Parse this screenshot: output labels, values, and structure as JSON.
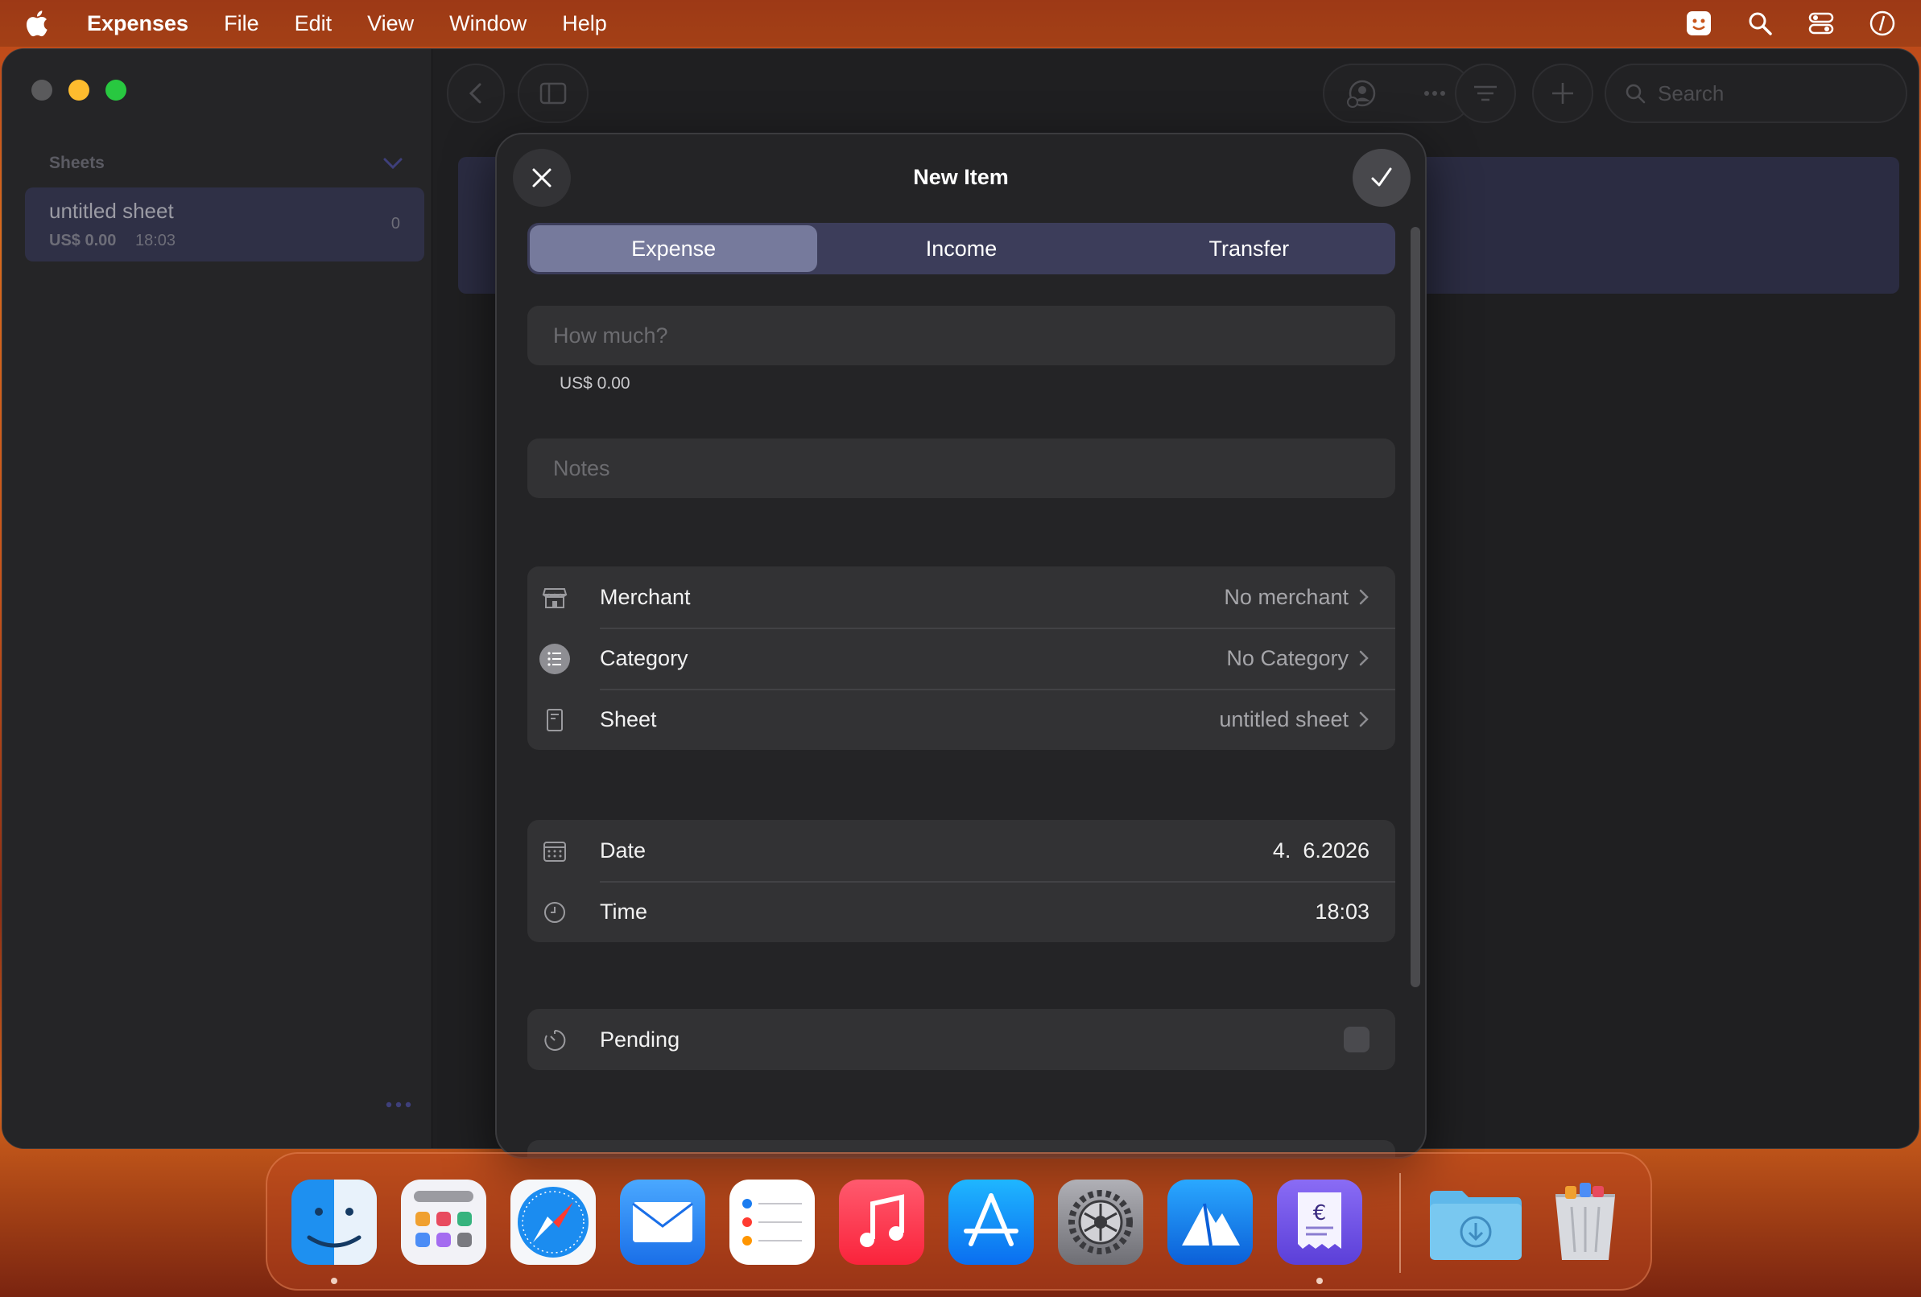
{
  "menubar": {
    "app_name": "Expenses",
    "items": [
      "File",
      "Edit",
      "View",
      "Window",
      "Help"
    ]
  },
  "sidebar": {
    "section_title": "Sheets",
    "sheets": [
      {
        "name": "untitled sheet",
        "amount": "US$ 0.00",
        "time": "18:03",
        "count": "0"
      }
    ]
  },
  "toolbar": {
    "search_placeholder": "Search"
  },
  "modal": {
    "title": "New Item",
    "segments": [
      "Expense",
      "Income",
      "Transfer"
    ],
    "selected_segment": "Expense",
    "amount_placeholder": "How much?",
    "amount_hint": "US$ 0.00",
    "notes_placeholder": "Notes",
    "details": {
      "merchant": {
        "label": "Merchant",
        "value": "No merchant"
      },
      "category": {
        "label": "Category",
        "value": "No Category"
      },
      "sheet": {
        "label": "Sheet",
        "value": "untitled sheet"
      }
    },
    "datetime": {
      "date": {
        "label": "Date",
        "value": "4.  6.2026"
      },
      "time": {
        "label": "Time",
        "value": "18:03"
      }
    },
    "pending": {
      "label": "Pending",
      "checked": false
    }
  },
  "colors": {
    "segment_bg": "#3c3d5a",
    "segment_active": "#767a9c",
    "sheet_selected": "#2f3046",
    "wallpaper": "#c8541a"
  },
  "dock": {
    "apps": [
      "finder-icon",
      "launchpad-icon",
      "safari-icon",
      "mail-icon",
      "reminders-icon",
      "music-icon",
      "app-store-icon",
      "system-settings-icon",
      "testflight-icon",
      "expenses-icon",
      "downloads-folder-icon",
      "trash-icon"
    ]
  }
}
